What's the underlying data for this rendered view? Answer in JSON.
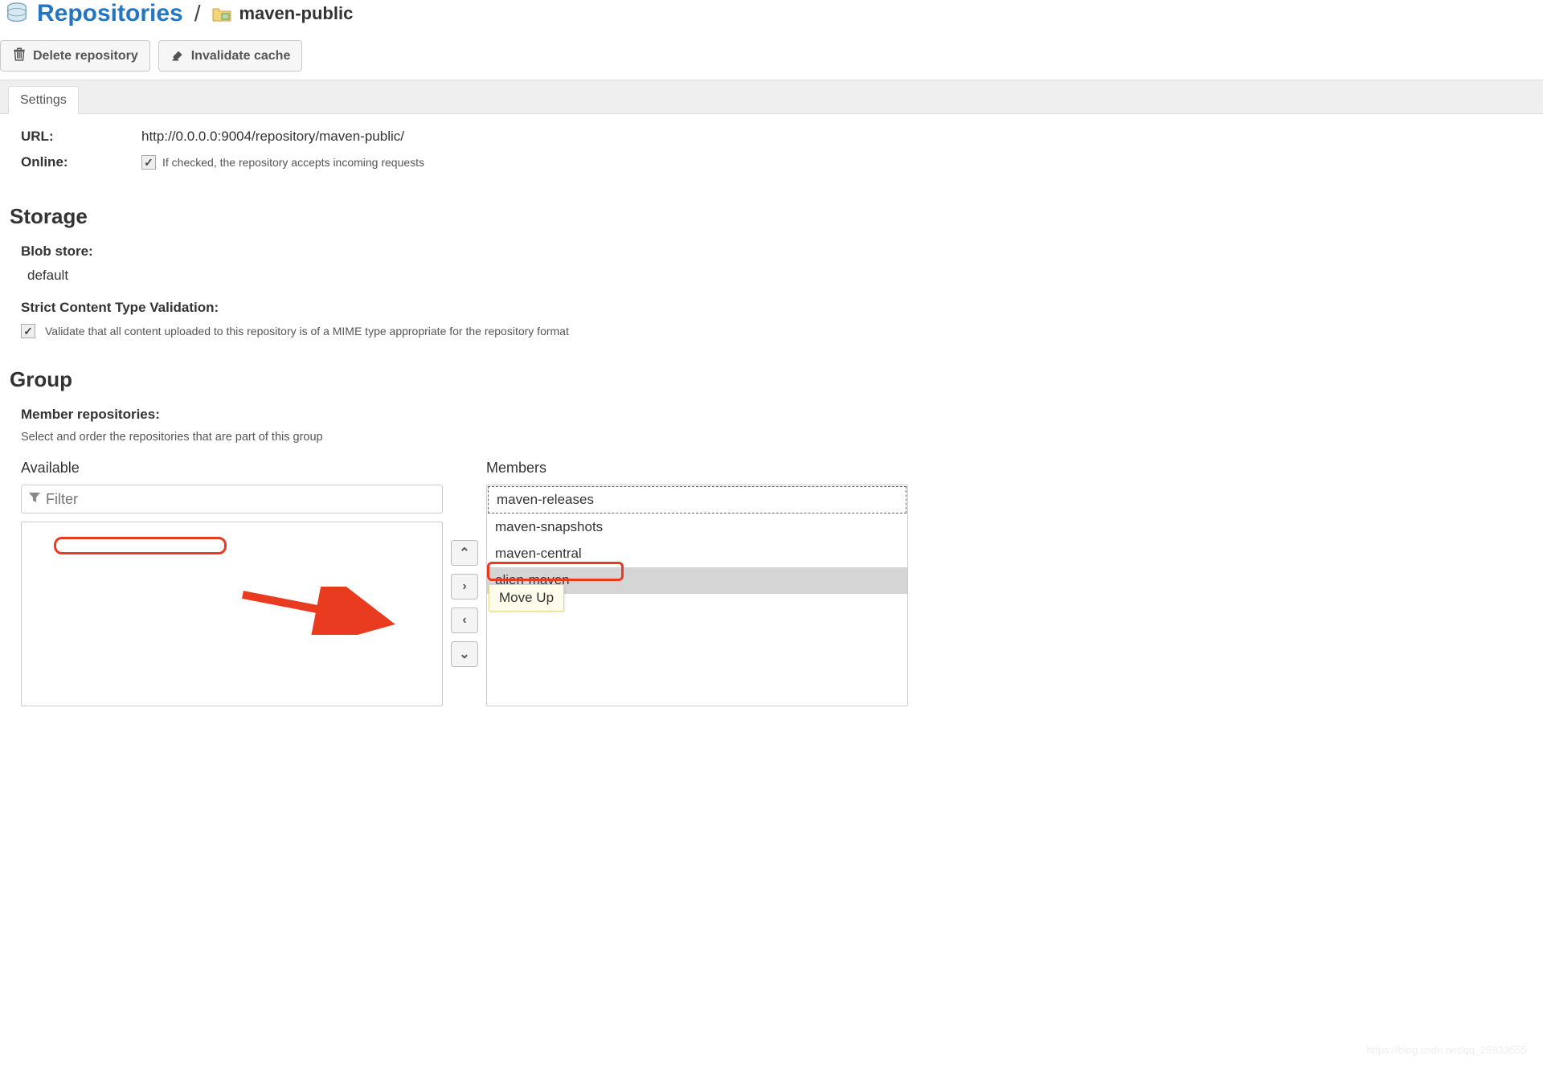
{
  "breadcrumb": {
    "root": "Repositories",
    "current": "maven-public"
  },
  "toolbar": {
    "delete": "Delete repository",
    "invalidate": "Invalidate cache"
  },
  "tabs": {
    "settings": "Settings"
  },
  "url": {
    "label": "URL:",
    "value": "http://0.0.0.0:9004/repository/maven-public/"
  },
  "online": {
    "label": "Online:",
    "hint": "If checked, the repository accepts incoming requests"
  },
  "storage": {
    "heading": "Storage",
    "blob_label": "Blob store:",
    "blob_value": "default",
    "strict_label": "Strict Content Type Validation:",
    "strict_hint": "Validate that all content uploaded to this repository is of a MIME type appropriate for the repository format"
  },
  "group": {
    "heading": "Group",
    "member_label": "Member repositories:",
    "member_desc": "Select and order the repositories that are part of this group",
    "available_title": "Available",
    "members_title": "Members",
    "filter_placeholder": "Filter",
    "members": [
      "maven-releases",
      "maven-snapshots",
      "maven-central",
      "alien-maven"
    ],
    "tooltip": "Move Up"
  },
  "watermark": "https://blog.csdn.net/qq_25933555"
}
